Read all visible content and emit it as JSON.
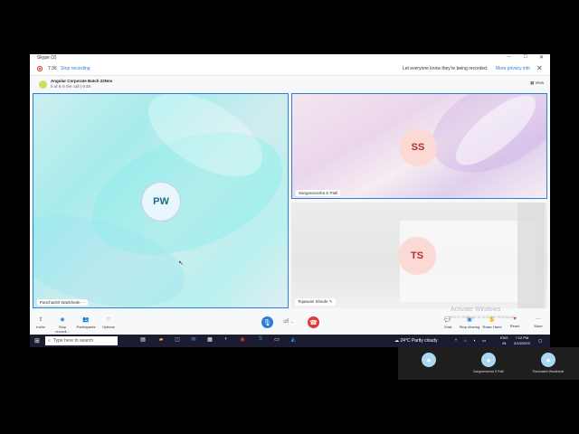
{
  "window": {
    "title": "Skype (2)",
    "controls": {
      "minimize": "–",
      "maximize": "□",
      "close": "✕"
    }
  },
  "recording": {
    "time": "7:36",
    "stop_label": "Stop recording",
    "message": "Let everyone know they're being recorded.",
    "privacy_link": "More privacy info"
  },
  "call": {
    "group_name": "Angular Corporate Batch 22Nov",
    "subtitle": "5 of 6 in the call | 9:48",
    "view_label": "View"
  },
  "participants": [
    {
      "initials": "PW",
      "name": "Panchashil Wankhede"
    },
    {
      "initials": "SS",
      "name": "Sangramsinha S Patil"
    },
    {
      "initials": "TS",
      "name": "Tejaswini Shinde"
    }
  ],
  "watermark": {
    "title": "Activate Windows",
    "subtitle": "Go to Settings to activate Windows."
  },
  "toolbar": {
    "invite": "Invite",
    "stop_recording": "Stop recordi...",
    "participants": "Participants",
    "options": "Options",
    "chat": "Chat",
    "stop_sharing": "Stop sharing",
    "raise_hand": "Raise Hand",
    "react": "React",
    "more": "More"
  },
  "taskbar": {
    "search_placeholder": "Type here to search",
    "weather": "24°C  Partly cloudy",
    "lang": "ENG",
    "region": "IN",
    "time": "7:12 PM",
    "date": "2/13/2023"
  },
  "mini_participants": [
    {
      "name": ""
    },
    {
      "name": "Sangramsinha S Patil"
    },
    {
      "name": "Panchashil Wankhede"
    }
  ]
}
